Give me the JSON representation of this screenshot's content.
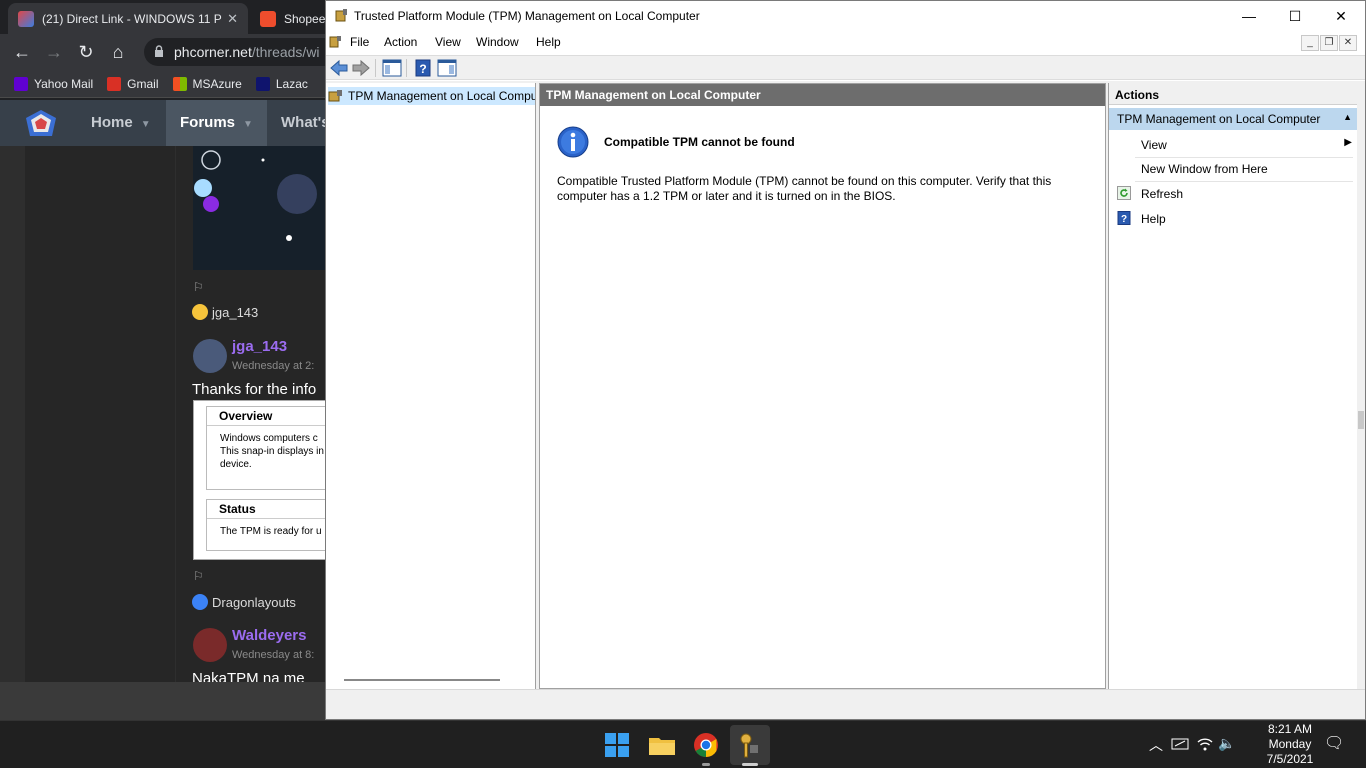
{
  "browser": {
    "tabs": [
      {
        "title": "(21) Direct Link - WINDOWS 11 P",
        "active": true,
        "close": "✕"
      },
      {
        "title": "Shopee",
        "active": false
      }
    ],
    "nav": {
      "back": "←",
      "forward": "→",
      "reload": "↻",
      "home": "⌂"
    },
    "url": {
      "host": "phcorner.net",
      "path": "/threads/wi"
    },
    "bookmarks": [
      "Yahoo Mail",
      "Gmail",
      "MSAzure",
      "Lazac"
    ],
    "site_nav": {
      "home": "Home",
      "forums": "Forums",
      "whats_new": "What's"
    },
    "thread": {
      "reaction1": "jga_143",
      "post1_user": "jga_143",
      "post1_date": "Wednesday at 2:",
      "post1_text": "Thanks for the info",
      "overview_head": "Overview",
      "overview_lines": [
        "Windows computers c",
        "This snap-in displays in",
        "device."
      ],
      "status_head": "Status",
      "status_line": "The TPM is ready for u",
      "reaction2": "Dragonlayouts",
      "post2_user": "Waldeyers",
      "post2_date": "Wednesday at 8:",
      "post2_text": "NakaTPM na me"
    }
  },
  "mmc": {
    "title": "Trusted Platform Module (TPM) Management on Local Computer",
    "window_controls": {
      "minimize": "—",
      "maximize": "☐",
      "close": "✕"
    },
    "menu": [
      "File",
      "Action",
      "View",
      "Window",
      "Help"
    ],
    "mdi_controls": {
      "minimize": "_",
      "restore": "❐",
      "close": "✕"
    },
    "tree": {
      "root": "TPM Management on Local Computer"
    },
    "result": {
      "header": "TPM Management on Local Computer",
      "message_title": "Compatible TPM cannot be found",
      "message_body": "Compatible Trusted Platform Module (TPM) cannot be found on this computer. Verify that this computer has a 1.2 TPM or later and it is turned on in the BIOS."
    },
    "actions": {
      "header": "Actions",
      "section": "TPM Management on Local Computer",
      "items": [
        "View",
        "New Window from Here",
        "Refresh",
        "Help"
      ]
    },
    "colors": {
      "selection": "#cce8ff",
      "result_header": "#6d6d6d",
      "actions_section": "#bcd7ee"
    }
  },
  "taskbar": {
    "time": "8:21 AM",
    "day": "Monday",
    "date": "7/5/2021",
    "tray": {
      "chevron": "︿",
      "volume": "🔈",
      "notifications": "🗨"
    }
  }
}
